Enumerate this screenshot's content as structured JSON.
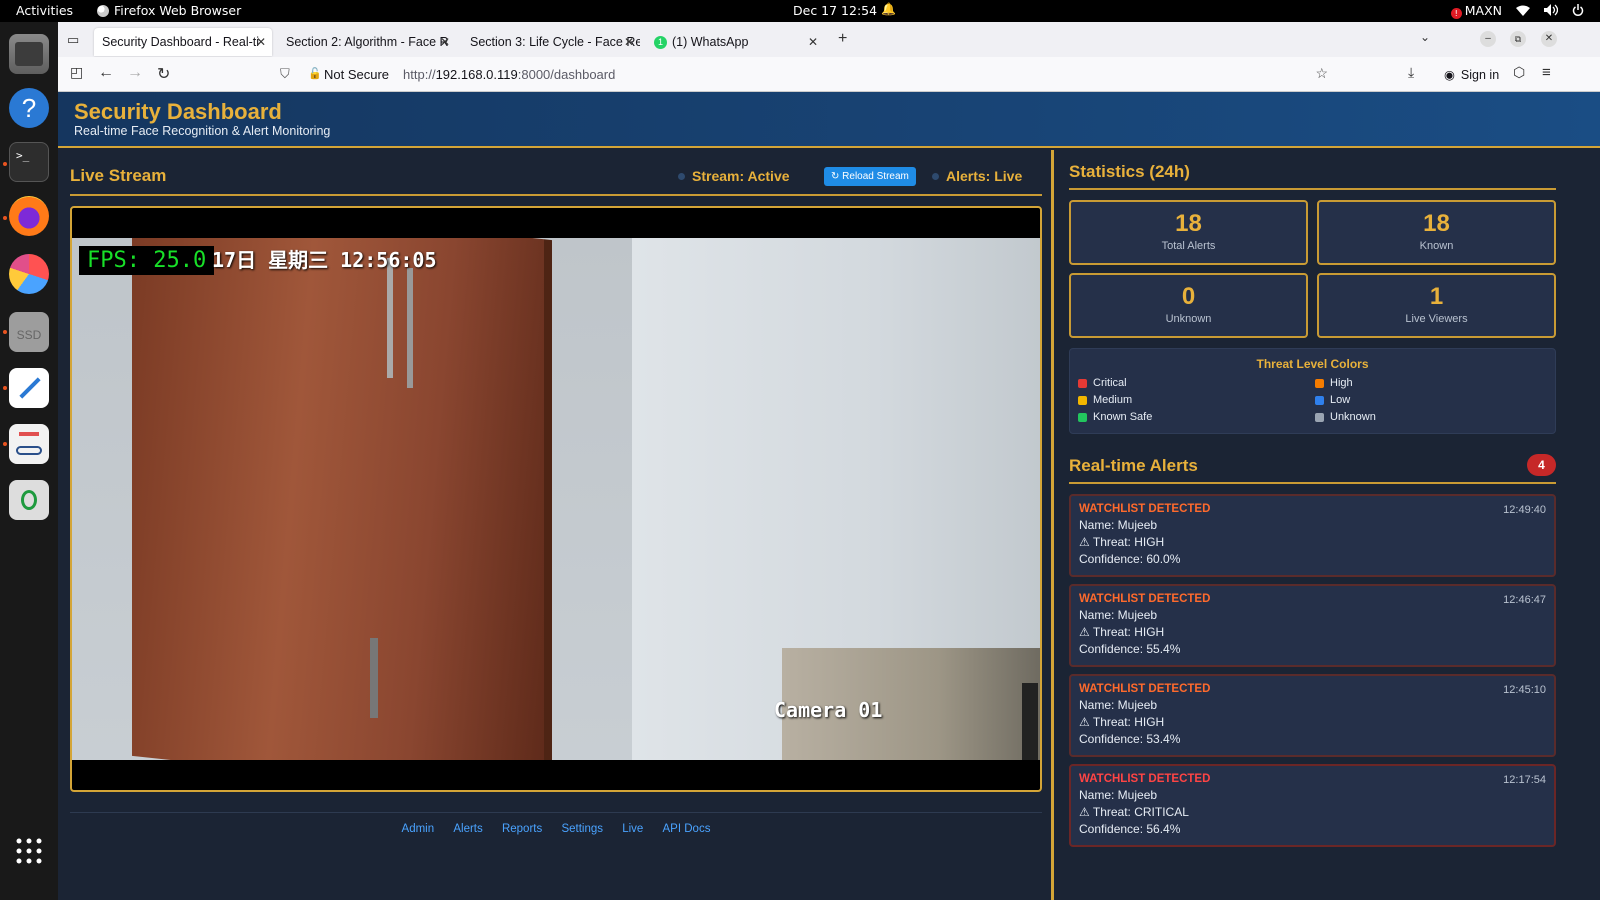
{
  "system_bar": {
    "activities": "Activities",
    "app_name": "Firefox Web Browser",
    "clock": "Dec 17  12:54",
    "power_mode": "MAXN",
    "power_badge": "!"
  },
  "browser": {
    "tabs": [
      {
        "label": "Security Dashboard - Real-ti",
        "active": true
      },
      {
        "label": "Section 2: Algorithm - Face R"
      },
      {
        "label": "Section 3: Life Cycle - Face Re"
      },
      {
        "label": "(1) WhatsApp",
        "badge": "1"
      }
    ],
    "security_label": "Not Secure",
    "url_prefix": "http://",
    "url_host": "192.168.0.119",
    "url_path": ":8000/dashboard",
    "sign_in": "Sign in"
  },
  "header": {
    "title": "Security Dashboard",
    "subtitle": "Real-time Face Recognition & Alert Monitoring"
  },
  "stream": {
    "title": "Live Stream",
    "status": "Stream: Active",
    "reload_label": "↻ Reload Stream",
    "alerts_status": "Alerts: Live",
    "fps": "FPS: 25.0",
    "osd_datetime": "17日  星期三  12:56:05",
    "camera_label": "Camera 01"
  },
  "footer_links": [
    "Admin",
    "Alerts",
    "Reports",
    "Settings",
    "Live",
    "API Docs"
  ],
  "statistics": {
    "title": "Statistics (24h)",
    "cards": [
      {
        "value": "18",
        "label": "Total Alerts"
      },
      {
        "value": "18",
        "label": "Known"
      },
      {
        "value": "0",
        "label": "Unknown"
      },
      {
        "value": "1",
        "label": "Live Viewers"
      }
    ]
  },
  "legend": {
    "title": "Threat Level Colors",
    "items": [
      {
        "label": "Critical",
        "color": "#e53935"
      },
      {
        "label": "High",
        "color": "#f57c00"
      },
      {
        "label": "Medium",
        "color": "#f2b600"
      },
      {
        "label": "Low",
        "color": "#2f80ed"
      },
      {
        "label": "Known Safe",
        "color": "#22c55e"
      },
      {
        "label": "Unknown",
        "color": "#9aa4b2"
      }
    ]
  },
  "alerts": {
    "title": "Real-time Alerts",
    "count": "4",
    "items": [
      {
        "type": "WATCHLIST DETECTED",
        "time": "12:49:40",
        "name": "Name: Mujeeb",
        "threat": "⚠ Threat: HIGH",
        "confidence": "Confidence: 60.0%",
        "color": "#ff6a2c"
      },
      {
        "type": "WATCHLIST DETECTED",
        "time": "12:46:47",
        "name": "Name: Mujeeb",
        "threat": "⚠ Threat: HIGH",
        "confidence": "Confidence: 55.4%",
        "color": "#ff6a2c"
      },
      {
        "type": "WATCHLIST DETECTED",
        "time": "12:45:10",
        "name": "Name: Mujeeb",
        "threat": "⚠ Threat: HIGH",
        "confidence": "Confidence: 53.4%",
        "color": "#ff6a2c"
      },
      {
        "type": "WATCHLIST DETECTED",
        "time": "12:17:54",
        "name": "Name: Mujeeb",
        "threat": "⚠ Threat: CRITICAL",
        "confidence": "Confidence: 56.4%",
        "color": "#ff4444"
      }
    ]
  },
  "dock": {
    "items": [
      "files-icon",
      "help-icon",
      "terminal-icon",
      "firefox-icon",
      "monitor-icon",
      "ssd-icon",
      "text-editor-icon",
      "document-viewer-icon",
      "recycle-bin-icon",
      "app-grid-icon"
    ],
    "ssd_label": "SSD"
  }
}
